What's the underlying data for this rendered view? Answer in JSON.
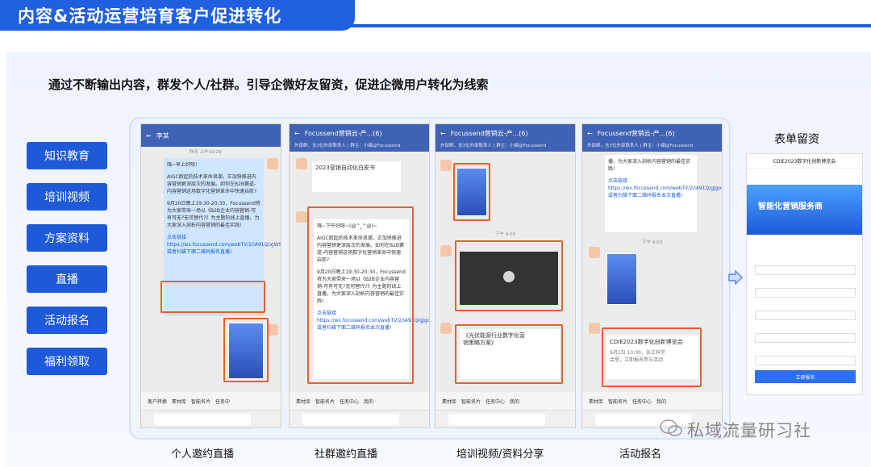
{
  "title": "内容&活动运营培育客户促进转化",
  "subtitle": "通过不断输出内容，群发个人/社群。引导企微好友留资，促进企微用户转化为线索",
  "categories": [
    "知识教育",
    "培训视频",
    "方案资料",
    "直播",
    "活动报名",
    "福利领取"
  ],
  "captions": [
    "个人邀约直播",
    "社群邀约直播",
    "培训视频/资料分享",
    "活动报名"
  ],
  "form": {
    "title": "表单留资",
    "page_title": "CDIE2023数字化创新博览会",
    "banner": "智能化营销服务商",
    "submit": "立即报名"
  },
  "phones": [
    {
      "header": "李某",
      "timestamp": "昨天 上午10:29",
      "tabs": [
        "客户转换",
        "素材库",
        "智能名片",
        "任务中"
      ]
    },
    {
      "header": "Focussend营销云-产...(6)",
      "sub": "外部群，含3位外部联系人 | 群主：小编@Focussend",
      "tabs": [
        "素材库",
        "智能名片",
        "任务中心",
        "我的"
      ]
    },
    {
      "header": "Focussend营销云-产...(6)",
      "sub": "外部群，含3位外部联系人 | 群主：小编@Focussend",
      "tabs": [
        "素材库",
        "智能名片",
        "任务中心",
        "我的"
      ]
    },
    {
      "header": "Focussend营销云-产...(6)",
      "sub": "外部群，含3位外部联系人 | 群主：小编@Focussend",
      "tabs": [
        "素材库",
        "智能名片",
        "任务中心",
        "我的"
      ]
    }
  ],
  "msgs": {
    "p1_greeting": "嗨~早上好呀!",
    "p1_body": "AIGC掀起的技术革命浪潮，正加快推进内容营销更深层次的发展。如何在B2B赛道-内容营销这场数字化营销革命中快速启航?",
    "p1_event": "9月20日晚上19:30-20:30，Focussend将为大家带来一场以《B2B企业内容营销-可有可无?无可替代?》为主题的线上直播，为大家深入剖析内容营销的最佳实践!",
    "p1_link": "点击链接https://wx.focussend.com/webTV/2/iA91Q/xJWSO9或者扫描下面二维码报名直播!",
    "p2_card": "2023营销自动化白皮书",
    "p2_greeting": "嗨~下午好呀~(@^_^@)~",
    "p2_body": "AIGC掀起的技术革命浪潮，正加快推进内容营销更深层次的发展。如何在B2B赛道-内容营销这场数字化营销革命中快速启航?",
    "p2_event": "9月20日晚上19:30-20:30，Focussend将为大家带来一场以《B2B企业内容营销-可有可无?无可替代?》为主题的线上直播，为大家深入剖析内容营销的最佳实践!",
    "p2_link": "点击链接https://wx.focussend.com/webTV/2/iA91Q/gJgorhm或者扫描下面二维码报名本次直播!",
    "p3_time": "下午 4:03",
    "p3_doc": "《光伏能源行业数字化营销策略方案》",
    "p4_event": "播，为大家深入剖析内容营销的最佳实践!",
    "p4_link": "点击链接https://wx.focussend.com/webTV/2/iA91Q/gJgorhm或者扫描下面二维码报名本次直播!",
    "p4_card": "CDIE2023数字化创新博览会",
    "p4_card_sub": "9月1日 10:00，张江科学会堂，立即报名参与活动"
  },
  "watermark": "私域流量研习社",
  "colors": {
    "brand": "#1f5fe0",
    "highlight": "#e7602f"
  }
}
